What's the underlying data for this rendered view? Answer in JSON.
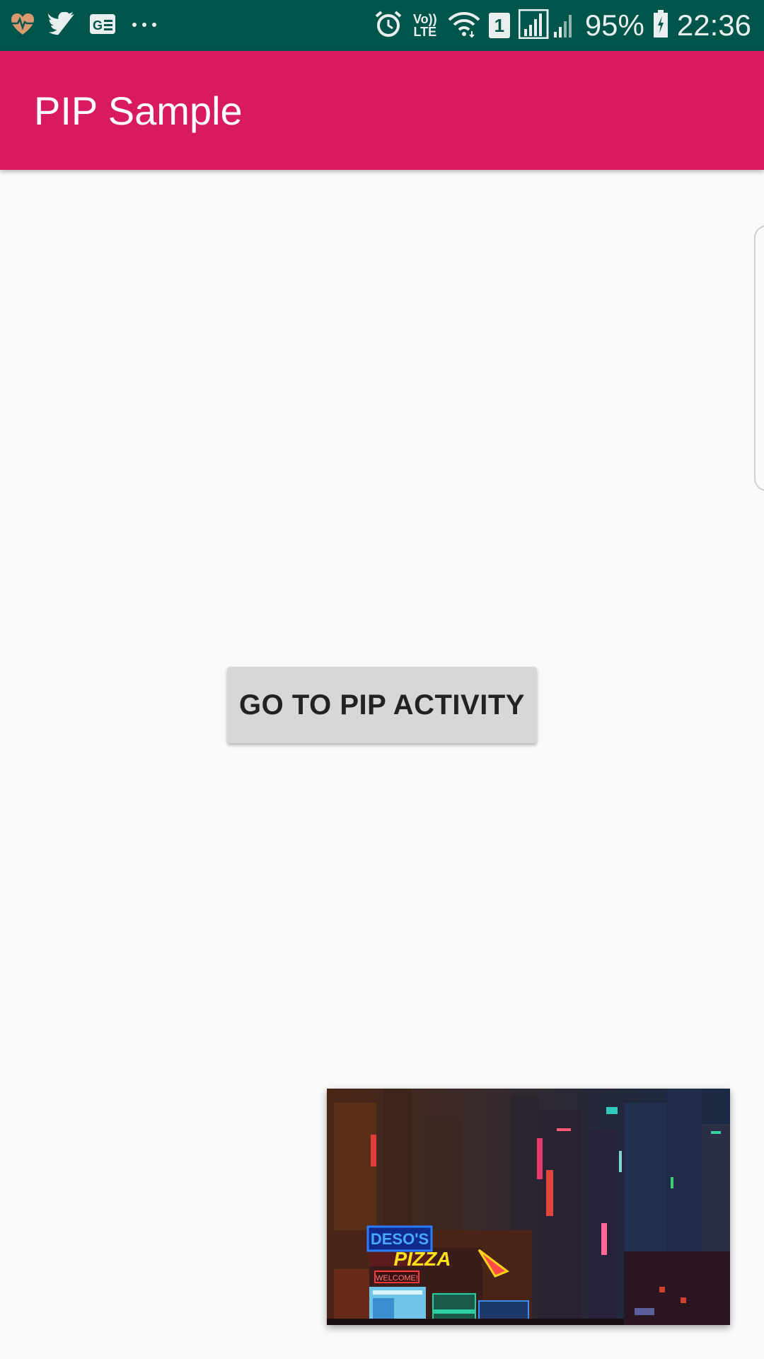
{
  "status_bar": {
    "left_icons": [
      "heart-pulse-icon",
      "twitter-icon",
      "news-icon",
      "more-dots-icon"
    ],
    "right_icons": [
      "alarm-icon",
      "volte-icon",
      "wifi-icon",
      "sim-icon",
      "signal-icon",
      "battery-icon"
    ],
    "volte_line1": "Vo))",
    "volte_line2": "LTE",
    "sim_label": "1",
    "battery": "95%",
    "time": "22:36"
  },
  "app_bar": {
    "title": "PIP Sample",
    "color": "#d81b60"
  },
  "main": {
    "button_label": "GO TO PIP ACTIVITY"
  },
  "pip_window": {
    "sign_deso": "DESO'S",
    "sign_pizza": "PIZZA",
    "sign_welcome": "WELCOME!"
  },
  "colors": {
    "status_bar": "#00554a",
    "background": "#fafafa",
    "button": "#d7d7d7"
  }
}
